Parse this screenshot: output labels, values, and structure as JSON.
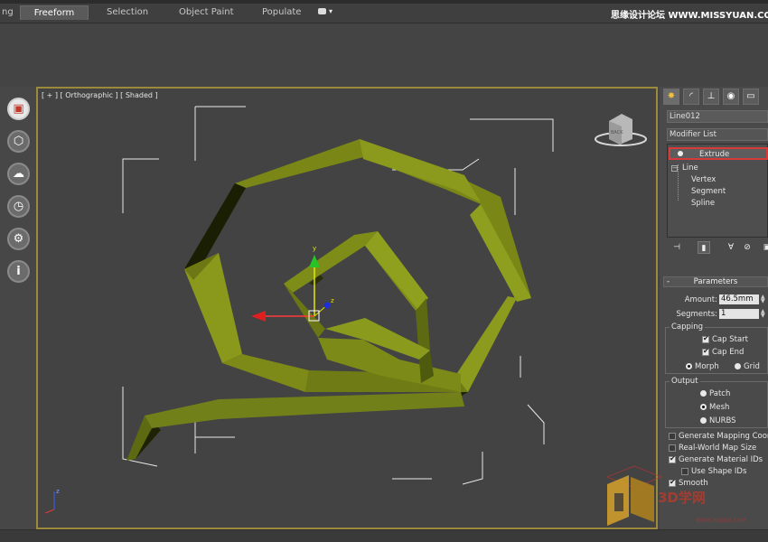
{
  "ribbon": {
    "tabs": [
      {
        "label": "ng"
      },
      {
        "label": "Freeform",
        "active": true
      },
      {
        "label": "Selection"
      },
      {
        "label": "Object Paint"
      },
      {
        "label": "Populate"
      }
    ]
  },
  "watermark_top": "思缘设计论坛 WWW.MISSYUAN.COM",
  "left_toolbar": {
    "items": [
      {
        "icon": "box-icon",
        "active": true
      },
      {
        "icon": "cube-icon"
      },
      {
        "icon": "cloud-icon"
      },
      {
        "icon": "clock-icon"
      },
      {
        "icon": "gear-icon"
      },
      {
        "icon": "info-icon"
      }
    ]
  },
  "viewport": {
    "label": "[ + ] [ Orthographic ] [ Shaded ]",
    "viewcube_label": "BACK",
    "gizmo": {
      "y": "y",
      "z": "z"
    },
    "axis_tripod": {
      "z": "z"
    },
    "object_color": "#7d8a16"
  },
  "command_panel": {
    "object_name": "Line012",
    "modifier_list": "Modifier List",
    "stack": {
      "modifier": "Extrude",
      "base_object": "Line",
      "sub_objects": [
        "Vertex",
        "Segment",
        "Spline"
      ]
    },
    "parameters": {
      "title": "Parameters",
      "amount_label": "Amount:",
      "amount_value": "46.5mm",
      "segments_label": "Segments:",
      "segments_value": "1",
      "capping": {
        "title": "Capping",
        "cap_start": "Cap Start",
        "cap_end": "Cap End",
        "morph": "Morph",
        "grid": "Grid"
      },
      "output": {
        "title": "Output",
        "patch": "Patch",
        "mesh": "Mesh",
        "nurbs": "NURBS"
      },
      "options": {
        "generate_mapping": "Generate Mapping Coords.",
        "real_world": "Real-World Map Size",
        "material_ids": "Generate Material IDs",
        "use_shape_ids": "Use Shape IDs",
        "smooth": "Smooth"
      }
    }
  },
  "brand": {
    "text": "3D学网",
    "sub": "WWW.3DXUE.COM"
  }
}
